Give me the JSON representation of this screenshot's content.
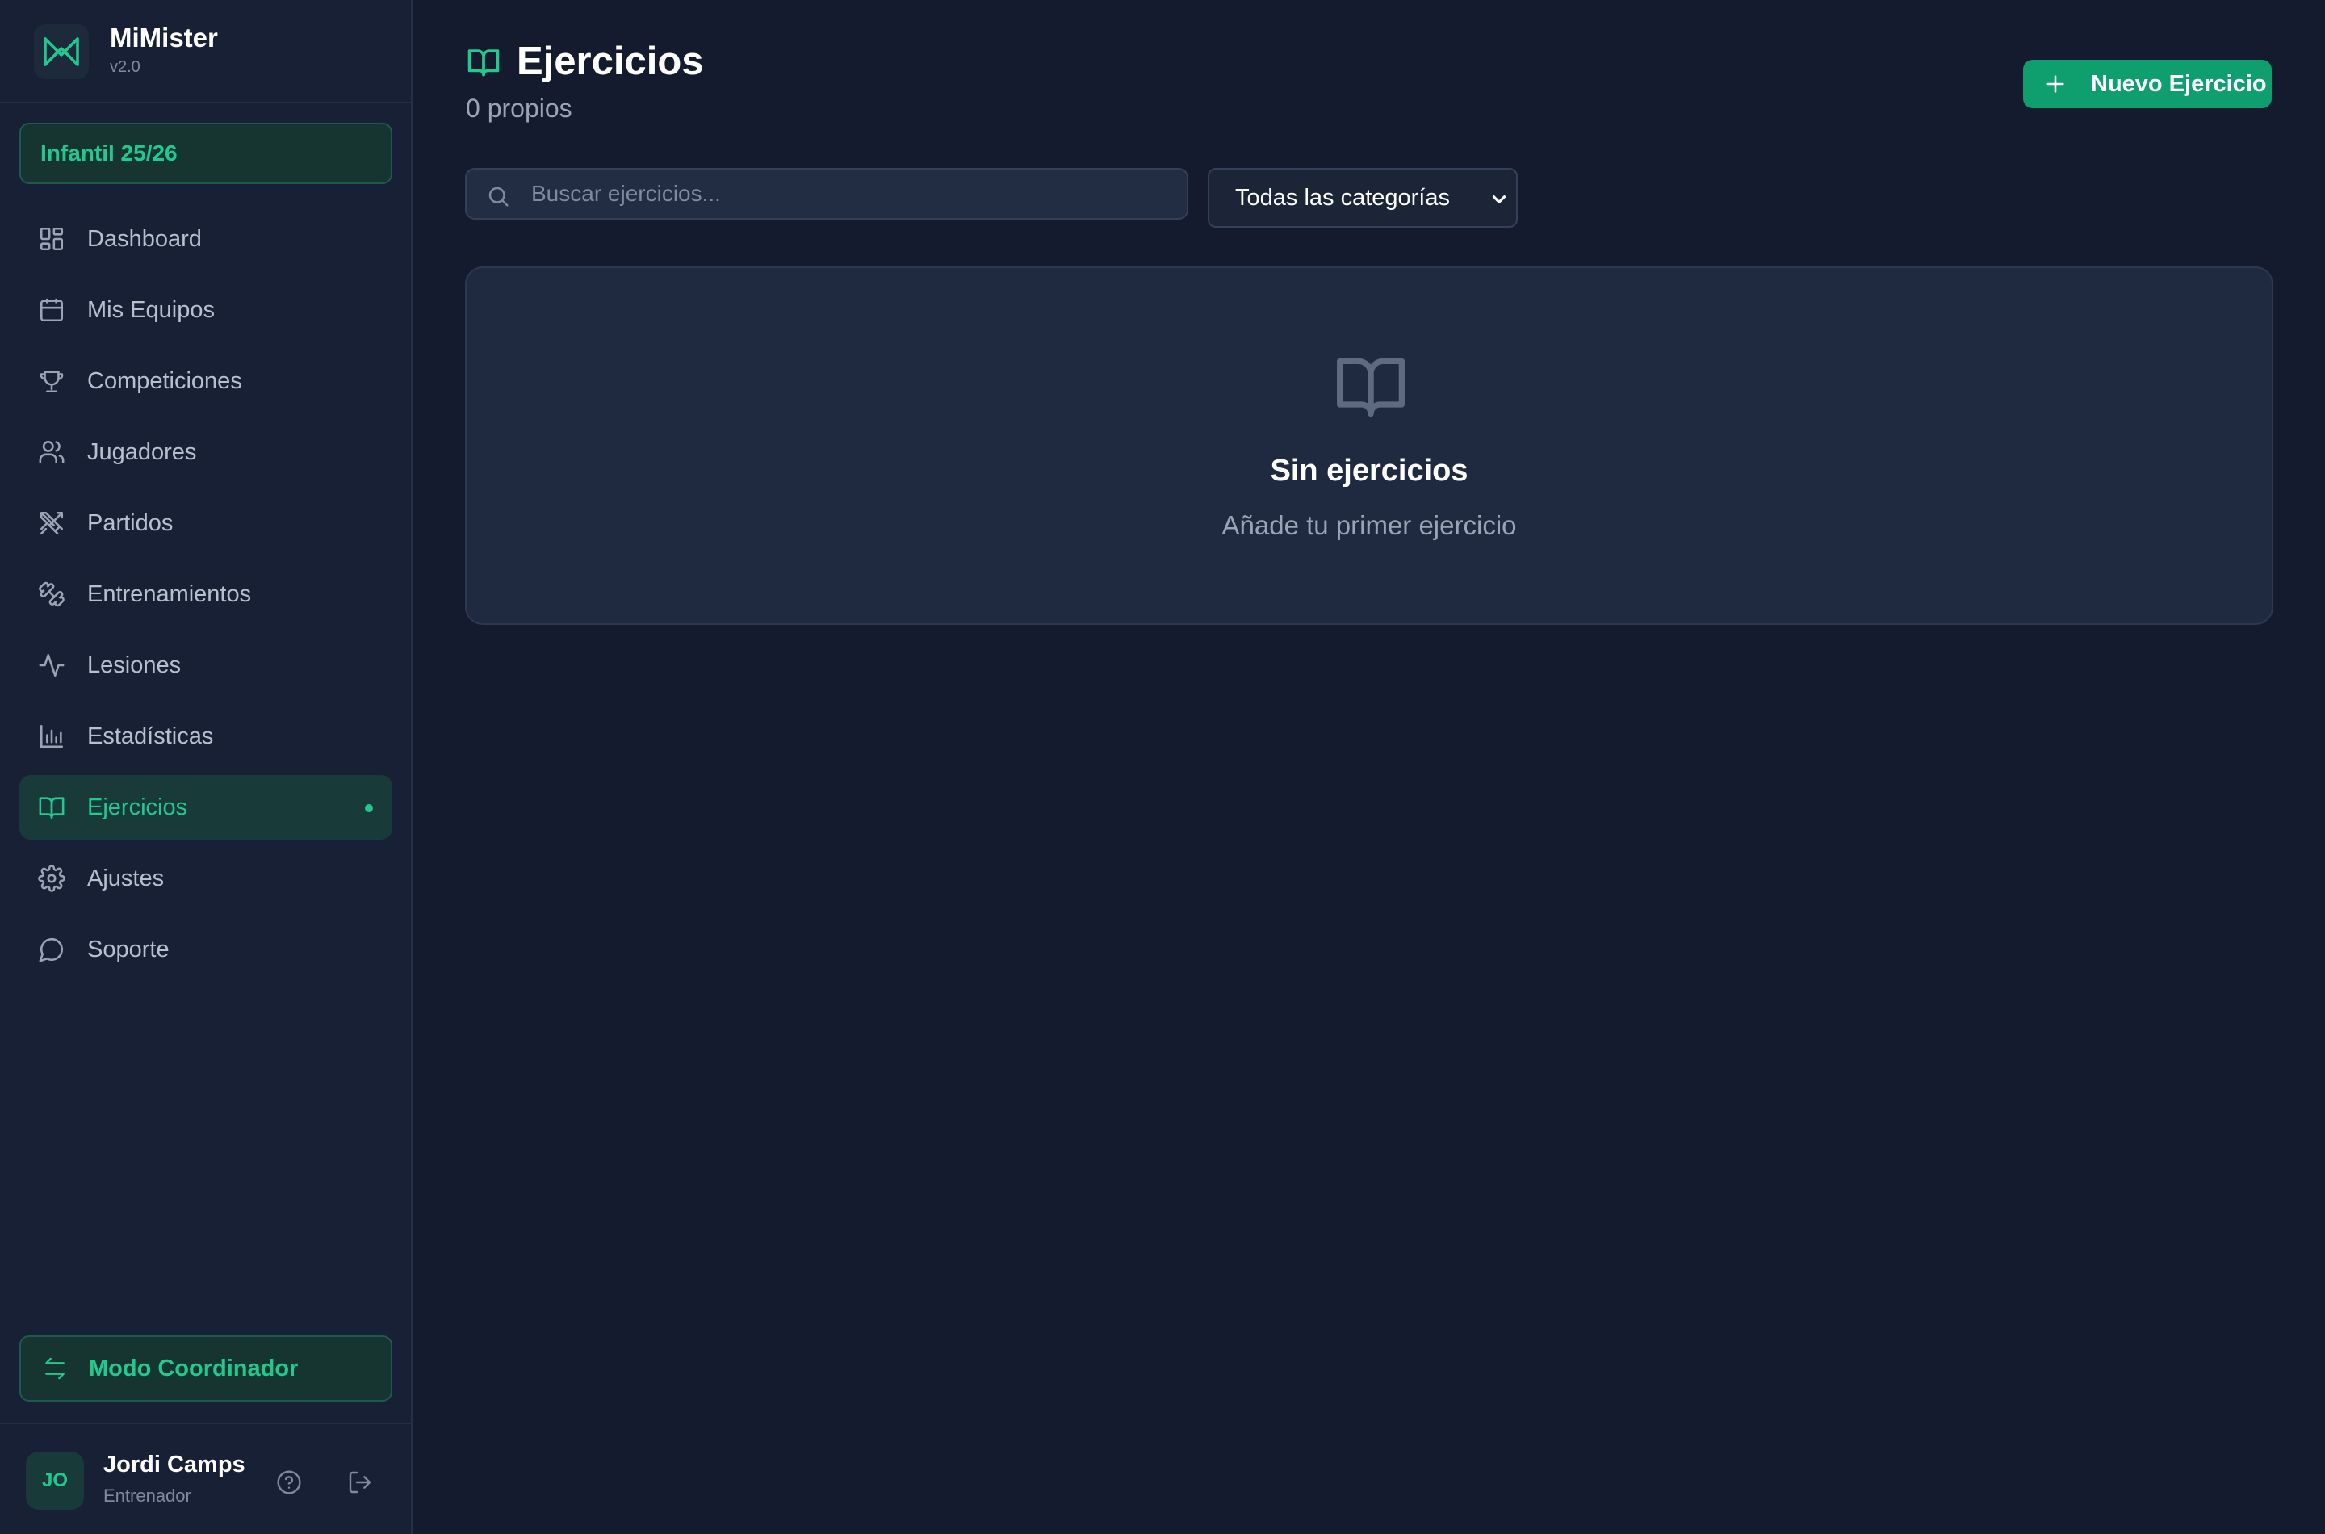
{
  "brand": {
    "name": "MiMister",
    "version": "v2.0"
  },
  "team_selector": {
    "label": "Infantil 25/26"
  },
  "sidebar": {
    "items": [
      {
        "label": "Dashboard",
        "icon": "dashboard-icon",
        "active": false
      },
      {
        "label": "Mis Equipos",
        "icon": "calendar-icon",
        "active": false
      },
      {
        "label": "Competiciones",
        "icon": "trophy-icon",
        "active": false
      },
      {
        "label": "Jugadores",
        "icon": "users-icon",
        "active": false
      },
      {
        "label": "Partidos",
        "icon": "swords-icon",
        "active": false
      },
      {
        "label": "Entrenamientos",
        "icon": "dumbbell-icon",
        "active": false
      },
      {
        "label": "Lesiones",
        "icon": "activity-icon",
        "active": false
      },
      {
        "label": "Estadísticas",
        "icon": "bar-chart-icon",
        "active": false
      },
      {
        "label": "Ejercicios",
        "icon": "book-icon",
        "active": true
      },
      {
        "label": "Ajustes",
        "icon": "gear-icon",
        "active": false
      },
      {
        "label": "Soporte",
        "icon": "chat-icon",
        "active": false
      }
    ]
  },
  "coordinator_mode": {
    "label": "Modo Coordinador"
  },
  "user": {
    "initials": "JO",
    "name": "Jordi Camps",
    "role": "Entrenador"
  },
  "main": {
    "title": "Ejercicios",
    "subtitle": "0 propios",
    "new_button_label": "Nuevo Ejercicio",
    "search": {
      "placeholder": "Buscar ejercicios...",
      "value": ""
    },
    "category_filter": {
      "selected": "Todas las categorías"
    },
    "empty_state": {
      "title": "Sin ejercicios",
      "text": "Añade tu primer ejercicio"
    }
  },
  "colors": {
    "accent": "#22c98f",
    "primary_button": "#0f9e6e",
    "background": "#151b2e",
    "sidebar": "#182036",
    "card": "#1f2940"
  }
}
